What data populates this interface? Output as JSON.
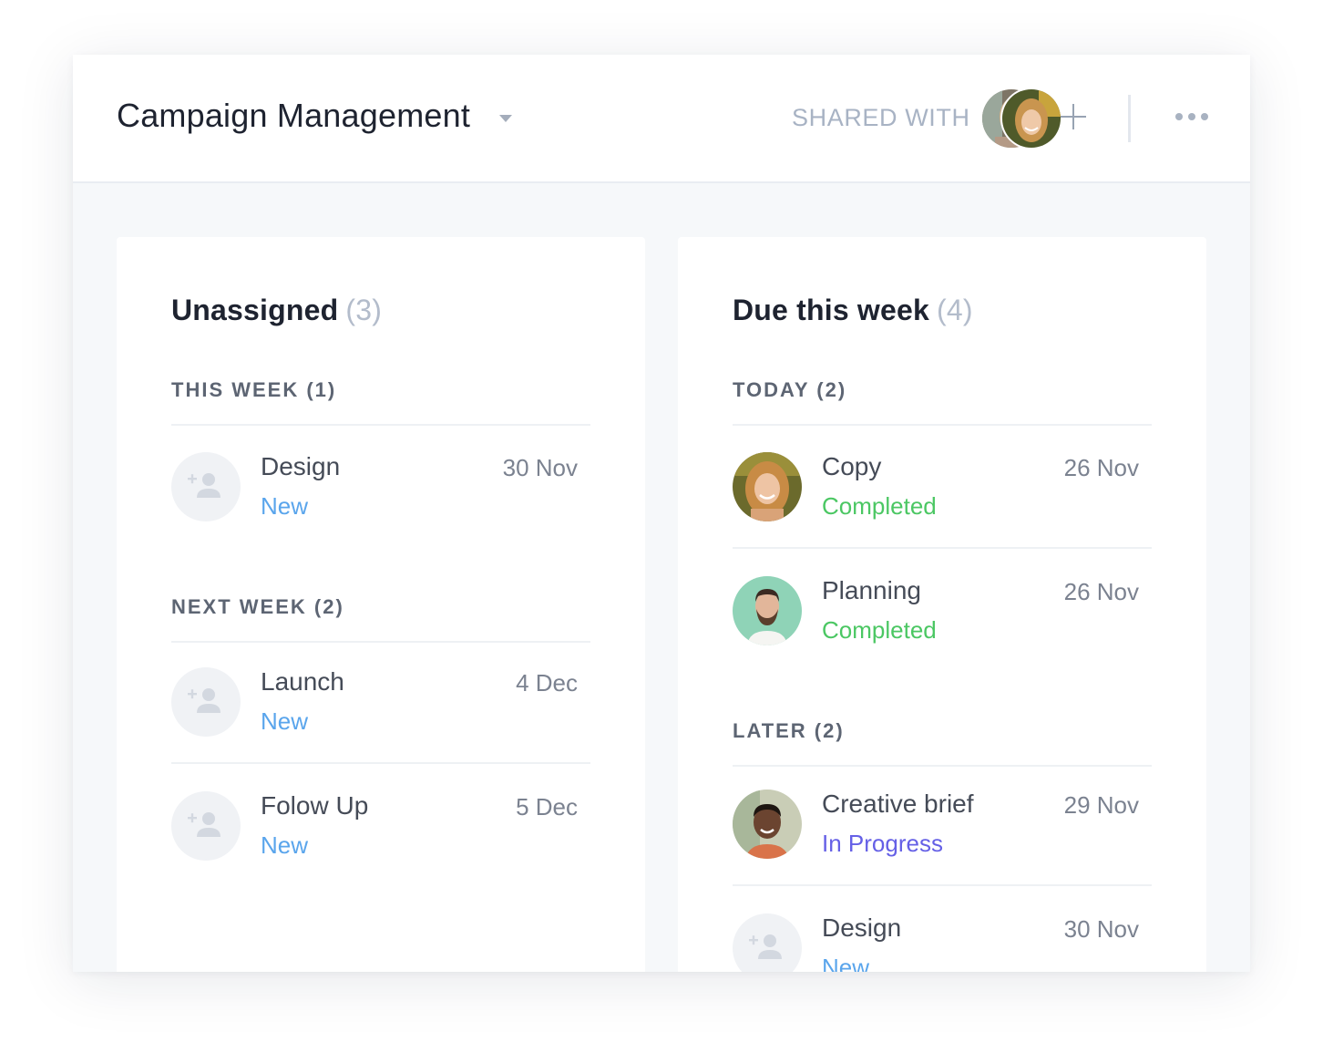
{
  "header": {
    "title": "Campaign Management",
    "shared_label": "SHARED WITH"
  },
  "colors": {
    "status_new": "#5aa5ec",
    "status_completed": "#4bc763",
    "status_in_progress": "#6560e6"
  },
  "columns": [
    {
      "title": "Unassigned",
      "count": "(3)",
      "sections": [
        {
          "label": "THIS WEEK (1)",
          "tasks": [
            {
              "name": "Design",
              "status": "New",
              "date": "30 Nov",
              "avatar": "add-user-icon"
            }
          ]
        },
        {
          "label": "NEXT WEEK (2)",
          "tasks": [
            {
              "name": "Launch",
              "status": "New",
              "date": "4 Dec",
              "avatar": "add-user-icon"
            },
            {
              "name": "Folow Up",
              "status": "New",
              "date": "5 Dec",
              "avatar": "add-user-icon"
            }
          ]
        }
      ]
    },
    {
      "title": "Due this week",
      "count": "(4)",
      "sections": [
        {
          "label": "TODAY (2)",
          "tasks": [
            {
              "name": "Copy",
              "status": "Completed",
              "date": "26 Nov",
              "avatar": "woman-blonde-photo"
            },
            {
              "name": "Planning",
              "status": "Completed",
              "date": "26 Nov",
              "avatar": "man-beard-photo"
            }
          ]
        },
        {
          "label": "LATER (2)",
          "tasks": [
            {
              "name": "Creative brief",
              "status": "In Progress",
              "date": "29 Nov",
              "avatar": "man-smiling-photo"
            },
            {
              "name": "Design",
              "status": "New",
              "date": "30 Nov",
              "avatar": "add-user-icon"
            }
          ]
        }
      ]
    }
  ]
}
